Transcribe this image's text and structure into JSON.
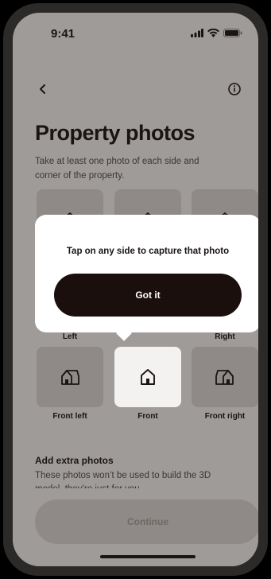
{
  "status_bar": {
    "time": "9:41"
  },
  "header": {
    "back_icon": "chevron-left-icon",
    "info_icon": "info-icon"
  },
  "page": {
    "title": "Property photos",
    "subtitle": "Take at least one photo of each side and corner of the property."
  },
  "tiles": {
    "left": "Left",
    "right": "Right",
    "front_left": "Front left",
    "front": "Front",
    "front_right": "Front right"
  },
  "popup": {
    "message": "Tap on any side to capture that photo",
    "button_label": "Got it"
  },
  "extra": {
    "title": "Add extra photos",
    "description": "These photos won’t be used to build the 3D model, they’re just for you."
  },
  "footer": {
    "continue_label": "Continue"
  }
}
